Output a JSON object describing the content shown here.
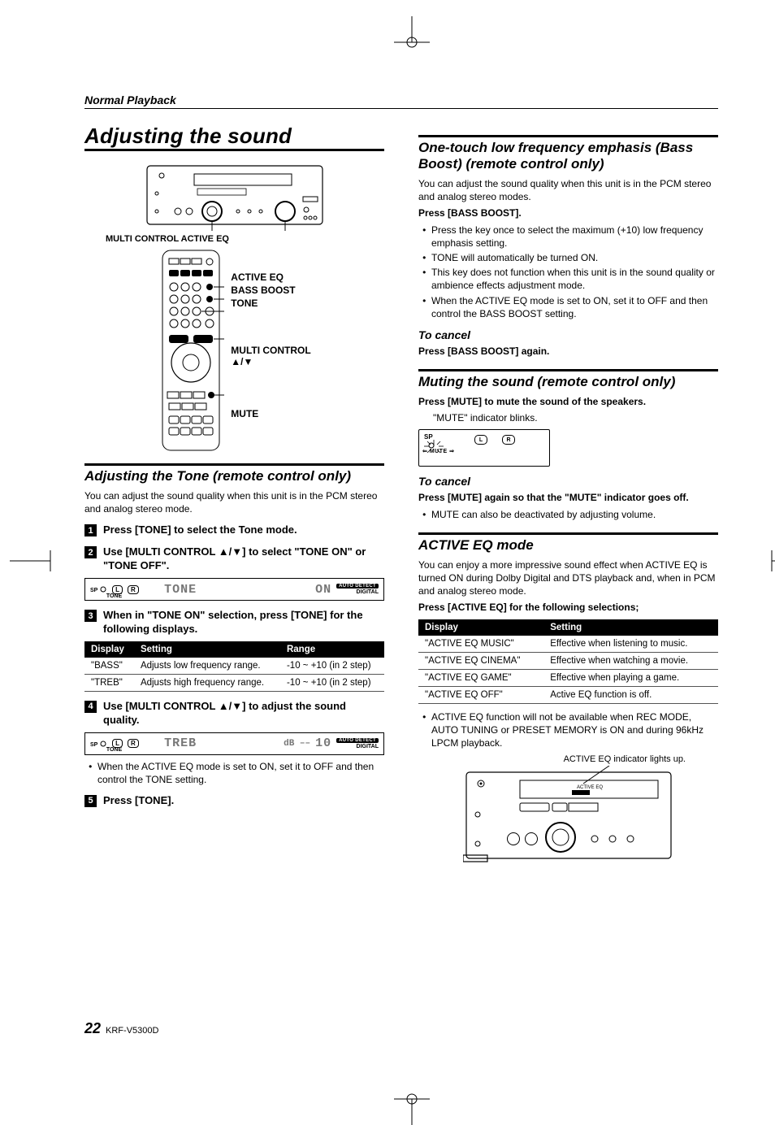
{
  "running_head": "Normal Playback",
  "title": "Adjusting the sound",
  "receiver_labels": "MULTI CONTROL   ACTIVE EQ",
  "remote_callouts": {
    "c1": "ACTIVE EQ",
    "c2": "BASS BOOST",
    "c3": "TONE",
    "c4": "MULTI CONTROL",
    "c5": "▲/▼",
    "c6": "MUTE"
  },
  "tone_section": {
    "heading": "Adjusting the Tone (remote control only)",
    "intro": "You can adjust the sound quality when this unit is in the PCM stereo and analog stereo mode.",
    "steps": {
      "s1": "Press [TONE] to select the Tone mode.",
      "s2": "Use [MULTI CONTROL ▲/▼] to select \"TONE ON\" or \"TONE OFF\".",
      "s3": "When in \"TONE ON\" selection, press [TONE] for the following displays.",
      "s4": "Use [MULTI CONTROL ▲/▼] to adjust the sound quality.",
      "s5": "Press [TONE]."
    },
    "lcd1_left": "TONE",
    "lcd1_right": "ON",
    "lcd2_left": "TREB",
    "lcd2_right": "10",
    "table_headers": [
      "Display",
      "Setting",
      "Range"
    ],
    "table_rows": [
      [
        "\"BASS\"",
        "Adjusts low frequency range.",
        "-10 ~ +10 (in 2 step)"
      ],
      [
        "\"TREB\"",
        "Adjusts high frequency range.",
        "-10 ~ +10 (in 2 step)"
      ]
    ],
    "note_eq": "When the ACTIVE EQ mode is set to ON, set it to OFF and then control the TONE setting."
  },
  "bass_section": {
    "heading": "One-touch low frequency emphasis (Bass Boost) (remote control only)",
    "intro": "You can adjust the sound quality when this unit is in the PCM stereo and analog stereo modes.",
    "press": "Press [BASS BOOST].",
    "bullets": [
      "Press the key once to select the maximum (+10) low frequency emphasis setting.",
      "TONE will automatically be turned ON.",
      "This key does not function when this unit is in the sound quality or ambience effects adjustment mode.",
      "When the ACTIVE EQ mode is set to ON, set it to OFF and then control the BASS BOOST setting."
    ],
    "cancel_h": "To cancel",
    "cancel_t": "Press [BASS BOOST] again."
  },
  "mute_section": {
    "heading": "Muting the sound (remote control only)",
    "press": "Press [MUTE] to mute the sound of the speakers.",
    "blinks": "\"MUTE\" indicator blinks.",
    "sp_label": "SP",
    "mute_label": "MUTE",
    "L": "L",
    "R": "R",
    "cancel_h": "To cancel",
    "cancel_t": "Press [MUTE] again so that the \"MUTE\" indicator goes off.",
    "note": "MUTE can also be deactivated by adjusting volume."
  },
  "eq_section": {
    "heading": "ACTIVE EQ mode",
    "intro": "You can enjoy a more impressive sound effect when ACTIVE EQ is turned ON during Dolby Digital and DTS playback and, when in PCM and analog stereo mode.",
    "press": "Press [ACTIVE EQ] for the following selections;",
    "table_headers": [
      "Display",
      "Setting"
    ],
    "table_rows": [
      [
        "\"ACTIVE EQ MUSIC\"",
        "Effective when listening to music."
      ],
      [
        "\"ACTIVE EQ CINEMA\"",
        "Effective when watching a movie."
      ],
      [
        "\"ACTIVE EQ GAME\"",
        "Effective when playing a game."
      ],
      [
        "\"ACTIVE EQ OFF\"",
        "Active EQ function is off."
      ]
    ],
    "note": "ACTIVE EQ function will not be available when REC MODE, AUTO TUNING or PRESET MEMORY is ON and during 96kHz LPCM playback.",
    "caption": "ACTIVE EQ indicator lights up."
  },
  "lcd_badge_auto": "AUTO DETECT",
  "lcd_badge_digital": "DIGITAL",
  "lcd_small_tone": "TONE",
  "footer_page": "22",
  "footer_model": "KRF-V5300D"
}
